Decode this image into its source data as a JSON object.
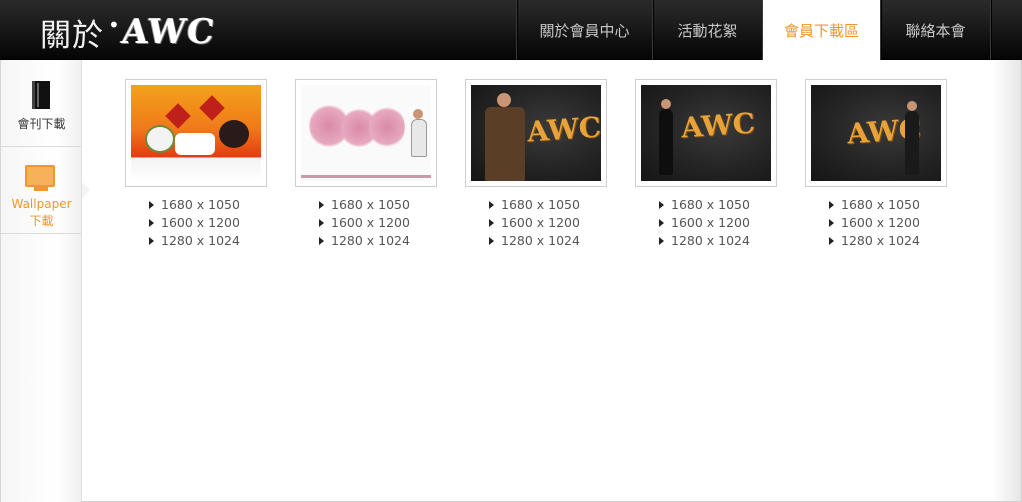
{
  "header": {
    "title_prefix": "關於",
    "logo_text": "AWC",
    "nav": [
      {
        "label": "關於會員中心",
        "active": false
      },
      {
        "label": "活動花絮",
        "active": false
      },
      {
        "label": "會員下載區",
        "active": true
      },
      {
        "label": "聯絡本會",
        "active": false
      }
    ]
  },
  "sidebar": {
    "items": [
      {
        "label": "會刊下載",
        "icon": "book-icon"
      },
      {
        "label_line1": "Wallpaper",
        "label_line2": "下載",
        "icon": "monitor-icon",
        "active": true
      }
    ]
  },
  "wallpapers": [
    {
      "resolutions": [
        "1680 x 1050",
        "1600 x 1200",
        "1280 x 1024"
      ]
    },
    {
      "resolutions": [
        "1680 x 1050",
        "1600 x 1200",
        "1280 x 1024"
      ]
    },
    {
      "resolutions": [
        "1680 x 1050",
        "1600 x 1200",
        "1280 x 1024"
      ],
      "thumb_text": "AWC"
    },
    {
      "resolutions": [
        "1680 x 1050",
        "1600 x 1200",
        "1280 x 1024"
      ],
      "thumb_text": "AWC"
    },
    {
      "resolutions": [
        "1680 x 1050",
        "1600 x 1200",
        "1280 x 1024"
      ],
      "thumb_text": "AWC"
    }
  ],
  "colors": {
    "accent": "#f0962d",
    "header_bg": "#141414"
  }
}
